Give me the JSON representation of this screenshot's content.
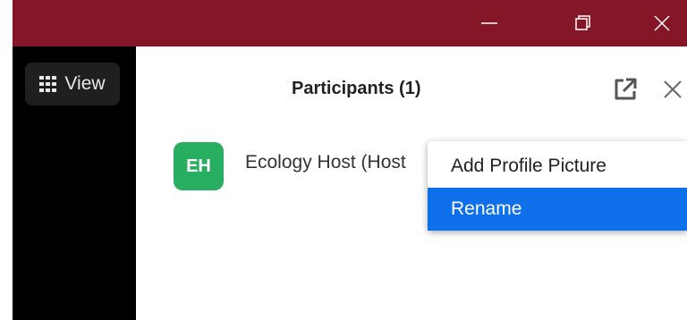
{
  "window": {
    "controls": [
      "minimize",
      "restore",
      "close"
    ],
    "titlebar_color": "#841628"
  },
  "toolbar": {
    "view_label": "View",
    "view_icon": "grid-icon"
  },
  "panel": {
    "title": "Participants (1)",
    "popout_icon": "popout-icon",
    "close_icon": "close-icon"
  },
  "participants": [
    {
      "initials": "EH",
      "name": "Ecology Host (Host",
      "avatar_color": "#27ae60"
    }
  ],
  "context_menu": {
    "items": [
      {
        "label": "Add Profile Picture",
        "selected": false
      },
      {
        "label": "Rename",
        "selected": true
      }
    ],
    "highlight_color": "#0e71eb"
  }
}
